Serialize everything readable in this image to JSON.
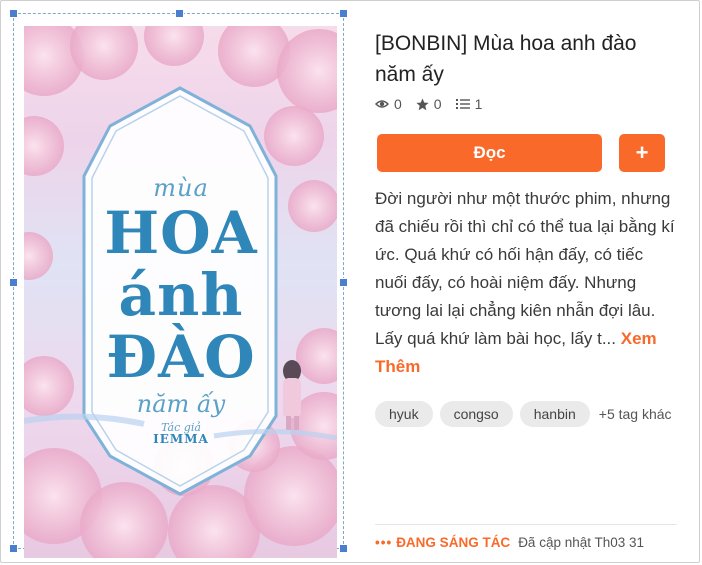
{
  "cover": {
    "small_title": "mùa",
    "big_title_1": "HOA",
    "big_title_2": "ánh",
    "big_title_3": "ĐÀO",
    "subtitle": "năm ấy",
    "author_label": "Tác giả",
    "author": "IEMMA"
  },
  "story": {
    "title": "[BONBIN] Mùa hoa anh đào năm ấy",
    "views": "0",
    "votes": "0",
    "parts": "1",
    "description": "Đời người như một thước phim, nhưng đã chiếu rồi thì chỉ có thể tua lại bằng kí ức. Quá khứ có hối hận đấy, có tiếc nuối đấy, có hoài niệm đấy. Nhưng tương lai lại chẳng kiên nhẫn đợi lâu. Lấy quá khứ làm bài học, lấy t...",
    "see_more": "Xem Thêm"
  },
  "actions": {
    "read_label": "Đọc",
    "add_label": "+"
  },
  "tags": [
    "hyuk",
    "congso",
    "hanbin"
  ],
  "tags_more": "+5 tag khác",
  "status": {
    "dots": "•••",
    "label": "ĐANG SÁNG TÁC",
    "updated": "Đã cập nhật Th03 31"
  },
  "colors": {
    "accent": "#f96a2a",
    "tag_bg": "#eaeaea",
    "cover_title": "#2f86b8"
  }
}
